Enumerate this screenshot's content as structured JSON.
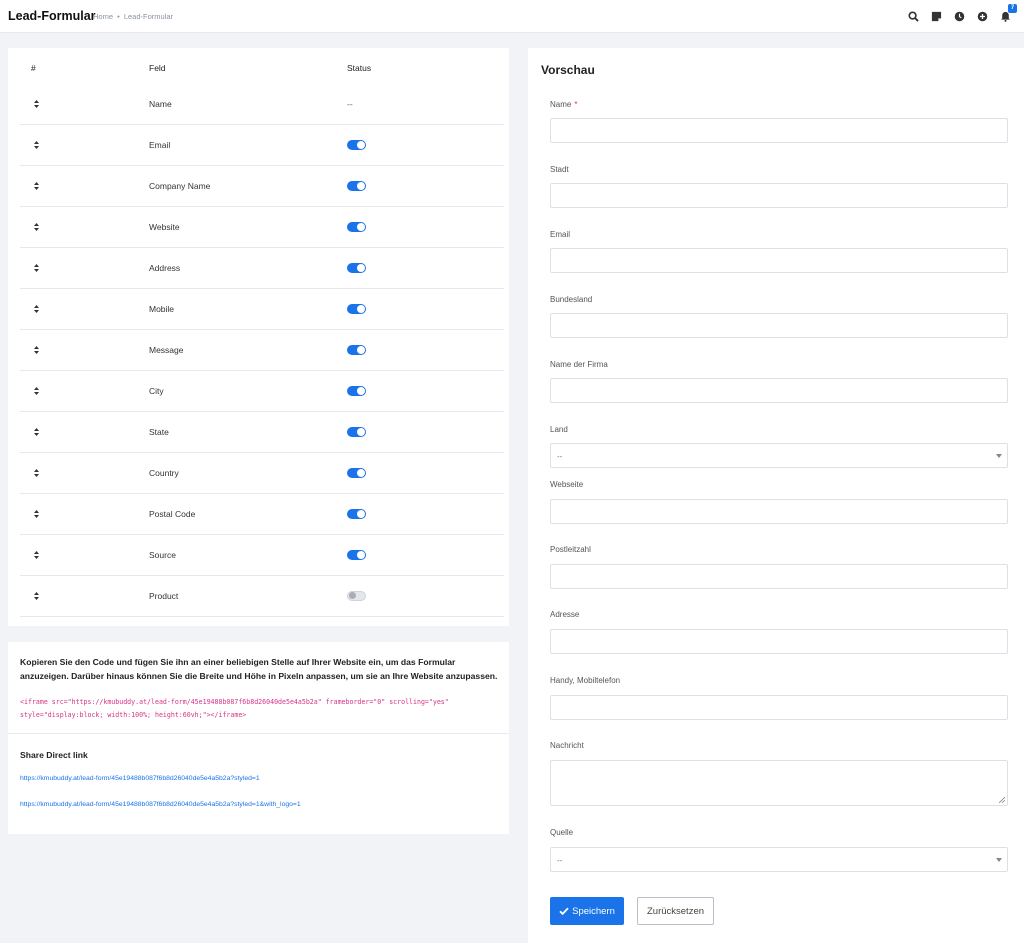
{
  "header": {
    "title": "Lead-Formular",
    "breadcrumb_home": "Home",
    "breadcrumb_sep": "•",
    "breadcrumb_current": "Lead-Formular",
    "notification_count": "7",
    "icons": [
      "search-icon",
      "note-icon",
      "clock-icon",
      "add-circle-icon",
      "bell-icon"
    ]
  },
  "fields_table": {
    "col_hash": "#",
    "col_field": "Feld",
    "col_status": "Status",
    "rows": [
      {
        "field": "Name",
        "status": "--",
        "enabled": null
      },
      {
        "field": "Email",
        "status": "",
        "enabled": true
      },
      {
        "field": "Company Name",
        "status": "",
        "enabled": true
      },
      {
        "field": "Website",
        "status": "",
        "enabled": true
      },
      {
        "field": "Address",
        "status": "",
        "enabled": true
      },
      {
        "field": "Mobile",
        "status": "",
        "enabled": true
      },
      {
        "field": "Message",
        "status": "",
        "enabled": true
      },
      {
        "field": "City",
        "status": "",
        "enabled": true
      },
      {
        "field": "State",
        "status": "",
        "enabled": true
      },
      {
        "field": "Country",
        "status": "",
        "enabled": true
      },
      {
        "field": "Postal Code",
        "status": "",
        "enabled": true
      },
      {
        "field": "Source",
        "status": "",
        "enabled": true
      },
      {
        "field": "Product",
        "status": "",
        "enabled": false
      }
    ]
  },
  "embed": {
    "instructions": "Kopieren Sie den Code und fügen Sie ihn an einer beliebigen Stelle auf Ihrer Website ein, um das Formular anzuzeigen. Darüber hinaus können Sie die Breite und Höhe in Pixeln anpassen, um sie an Ihre Website anzupassen.",
    "code": "<iframe src=\"https://kmubuddy.at/lead-form/45e19488b087f6b8d26040de5e4a5b2a\" frameborder=\"0\" scrolling=\"yes\" style=\"display:block; width:100%; height:60vh;\"></iframe>",
    "share_title": "Share Direct link",
    "link_styled": "https://kmubuddy.at/lead-form/45e19488b087f6b8d26040de5e4a5b2a?styled=1",
    "link_styled_logo": "https://kmubuddy.at/lead-form/45e19488b087f6b8d26040de5e4a5b2a?styled=1&with_logo=1"
  },
  "preview": {
    "title": "Vorschau",
    "required_mark": "*",
    "fields": [
      {
        "label": "Name",
        "type": "input",
        "required": true
      },
      {
        "label": "Stadt",
        "type": "input"
      },
      {
        "label": "Email",
        "type": "input"
      },
      {
        "label": "Bundesland",
        "type": "input"
      },
      {
        "label": "Name der Firma",
        "type": "input"
      },
      {
        "label": "Land",
        "type": "select",
        "value": "--"
      },
      {
        "label": "Webseite",
        "type": "input"
      },
      {
        "label": "Postleitzahl",
        "type": "input"
      },
      {
        "label": "Adresse",
        "type": "input"
      },
      {
        "label": "Handy, Mobiltelefon",
        "type": "input"
      },
      {
        "label": "Nachricht",
        "type": "textarea"
      },
      {
        "label": "Quelle",
        "type": "select",
        "value": "--"
      }
    ],
    "save_label": "Speichern",
    "reset_label": "Zurücksetzen"
  },
  "colors": {
    "accent": "#1a73e8",
    "required": "#e53935",
    "code": "#d63384"
  }
}
